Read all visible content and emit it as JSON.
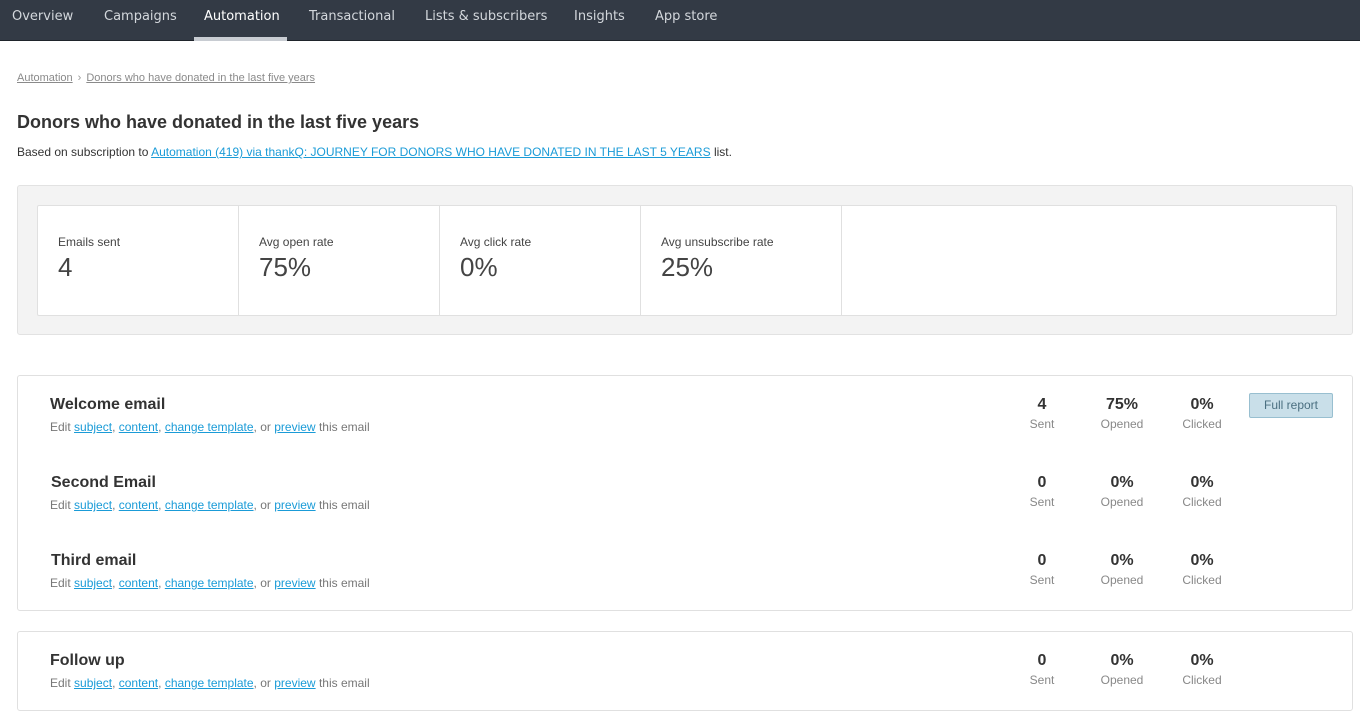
{
  "nav": {
    "tabs": [
      "Overview",
      "Campaigns",
      "Automation",
      "Transactional",
      "Lists & subscribers",
      "Insights",
      "App store"
    ],
    "active": "Automation"
  },
  "breadcrumb": {
    "root": "Automation",
    "separator": "›",
    "current": "Donors who have donated in the last five years"
  },
  "page": {
    "title": "Donors who have donated in the last five years",
    "subscription_prefix": "Based on subscription to",
    "subscription_link": "Automation (419) via thankQ: JOURNEY FOR DONORS WHO HAVE DONATED IN THE LAST 5 YEARS",
    "subscription_suffix": "list."
  },
  "stats": {
    "emails_sent": {
      "label": "Emails sent",
      "value": "4"
    },
    "avg_open_rate": {
      "label": "Avg open rate",
      "value": "75%"
    },
    "avg_click_rate": {
      "label": "Avg click rate",
      "value": "0%"
    },
    "avg_unsubscribe_rate": {
      "label": "Avg unsubscribe rate",
      "value": "25%"
    }
  },
  "edit_text": {
    "prefix": "Edit",
    "subject": "subject",
    "comma": ",",
    "content": "content",
    "change_template": "change template",
    "or": ", or",
    "preview": "preview",
    "suffix": "this email"
  },
  "metric_labels": {
    "sent": "Sent",
    "opened": "Opened",
    "clicked": "Clicked"
  },
  "full_report_label": "Full report",
  "emails": [
    {
      "name": "Welcome email",
      "sent": "4",
      "opened": "75%",
      "clicked": "0%"
    },
    {
      "name": "Second Email",
      "sent": "0",
      "opened": "0%",
      "clicked": "0%"
    },
    {
      "name": "Third email",
      "sent": "0",
      "opened": "0%",
      "clicked": "0%"
    },
    {
      "name": "Follow up",
      "sent": "0",
      "opened": "0%",
      "clicked": "0%"
    }
  ]
}
